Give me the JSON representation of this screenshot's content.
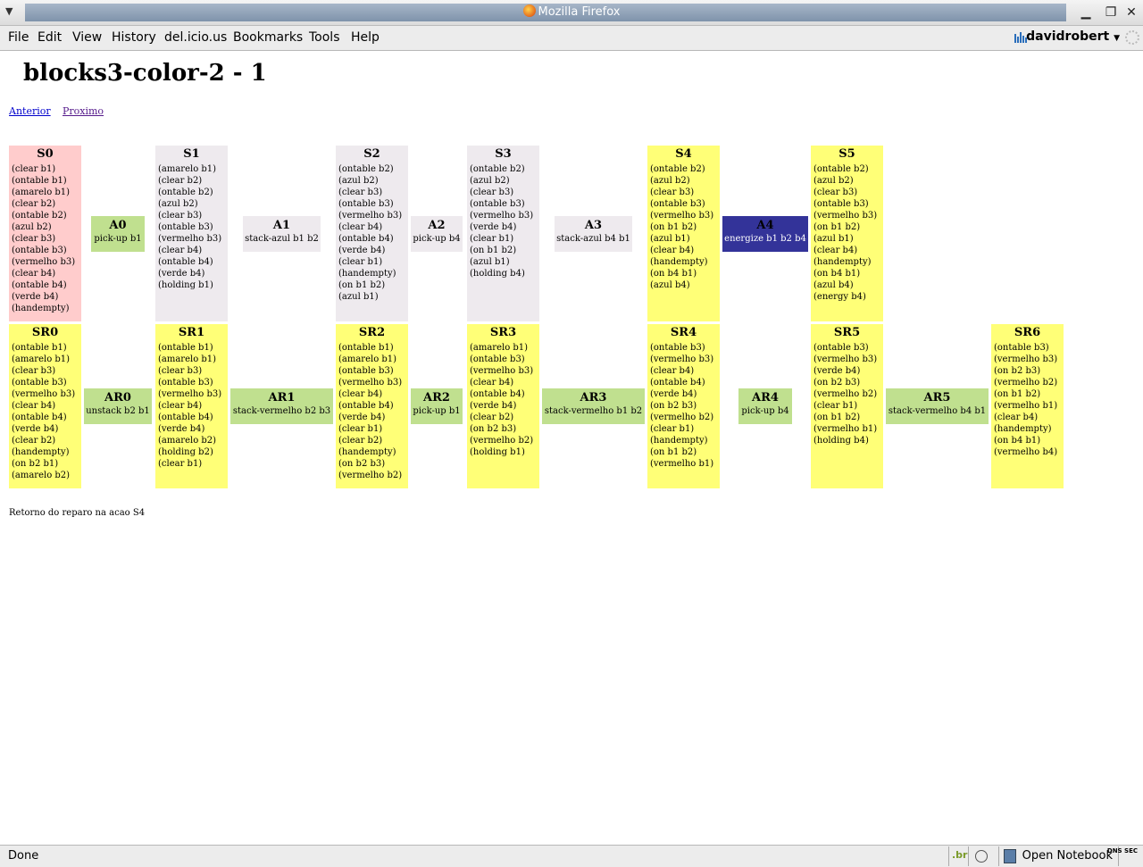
{
  "window": {
    "title": "Mozilla Firefox"
  },
  "menu": [
    "File",
    "Edit",
    "View",
    "History",
    "del.icio.us",
    "Bookmarks",
    "Tools",
    "Help"
  ],
  "user": "davidrobert",
  "page": {
    "title": "blocks3-color-2 - 1",
    "prev": "Anterior",
    "next": "Proximo",
    "note": "Retorno do reparo na acao S4"
  },
  "states_top": [
    {
      "name": "S0",
      "facts": [
        "(clear b1)",
        "(ontable b1)",
        "(amarelo b1)",
        "(clear b2)",
        "(ontable b2)",
        "(azul b2)",
        "(clear b3)",
        "(ontable b3)",
        "(vermelho b3)",
        "(clear b4)",
        "(ontable b4)",
        "(verde b4)",
        "(handempty)"
      ]
    },
    {
      "name": "S1",
      "facts": [
        "(amarelo b1)",
        "(clear b2)",
        "(ontable b2)",
        "(azul b2)",
        "(clear b3)",
        "(ontable b3)",
        "(vermelho b3)",
        "(clear b4)",
        "(ontable b4)",
        "(verde b4)",
        "(holding b1)"
      ]
    },
    {
      "name": "S2",
      "facts": [
        "(ontable b2)",
        "(azul b2)",
        "(clear b3)",
        "(ontable b3)",
        "(vermelho b3)",
        "(clear b4)",
        "(ontable b4)",
        "(verde b4)",
        "(clear b1)",
        "(handempty)",
        "(on b1 b2)",
        "(azul b1)"
      ]
    },
    {
      "name": "S3",
      "facts": [
        "(ontable b2)",
        "(azul b2)",
        "(clear b3)",
        "(ontable b3)",
        "(vermelho b3)",
        "(verde b4)",
        "(clear b1)",
        "(on b1 b2)",
        "(azul b1)",
        "(holding b4)"
      ]
    },
    {
      "name": "S4",
      "facts": [
        "(ontable b2)",
        "(azul b2)",
        "(clear b3)",
        "(ontable b3)",
        "(vermelho b3)",
        "(on b1 b2)",
        "(azul b1)",
        "(clear b4)",
        "(handempty)",
        "(on b4 b1)",
        "(azul b4)"
      ]
    },
    {
      "name": "S5",
      "facts": [
        "(ontable b2)",
        "(azul b2)",
        "(clear b3)",
        "(ontable b3)",
        "(vermelho b3)",
        "(on b1 b2)",
        "(azul b1)",
        "(clear b4)",
        "(handempty)",
        "(on b4 b1)",
        "(azul b4)",
        "(energy b4)"
      ]
    }
  ],
  "actions_top": [
    {
      "name": "A0",
      "label": "pick-up b1"
    },
    {
      "name": "A1",
      "label": "stack-azul b1 b2"
    },
    {
      "name": "A2",
      "label": "pick-up b4"
    },
    {
      "name": "A3",
      "label": "stack-azul b4 b1"
    },
    {
      "name": "A4",
      "label": "energize b1 b2 b4"
    }
  ],
  "states_bottom": [
    {
      "name": "SR0",
      "facts": [
        "(ontable b1)",
        "(amarelo b1)",
        "(clear b3)",
        "(ontable b3)",
        "(vermelho b3)",
        "(clear b4)",
        "(ontable b4)",
        "(verde b4)",
        "(clear b2)",
        "(handempty)",
        "(on b2 b1)",
        "(amarelo b2)"
      ]
    },
    {
      "name": "SR1",
      "facts": [
        "(ontable b1)",
        "(amarelo b1)",
        "(clear b3)",
        "(ontable b3)",
        "(vermelho b3)",
        "(clear b4)",
        "(ontable b4)",
        "(verde b4)",
        "(amarelo b2)",
        "(holding b2)",
        "(clear b1)"
      ]
    },
    {
      "name": "SR2",
      "facts": [
        "(ontable b1)",
        "(amarelo b1)",
        "(ontable b3)",
        "(vermelho b3)",
        "(clear b4)",
        "(ontable b4)",
        "(verde b4)",
        "(clear b1)",
        "(clear b2)",
        "(handempty)",
        "(on b2 b3)",
        "(vermelho b2)"
      ]
    },
    {
      "name": "SR3",
      "facts": [
        "(amarelo b1)",
        "(ontable b3)",
        "(vermelho b3)",
        "(clear b4)",
        "(ontable b4)",
        "(verde b4)",
        "(clear b2)",
        "(on b2 b3)",
        "(vermelho b2)",
        "(holding b1)"
      ]
    },
    {
      "name": "SR4",
      "facts": [
        "(ontable b3)",
        "(vermelho b3)",
        "(clear b4)",
        "(ontable b4)",
        "(verde b4)",
        "(on b2 b3)",
        "(vermelho b2)",
        "(clear b1)",
        "(handempty)",
        "(on b1 b2)",
        "(vermelho b1)"
      ]
    },
    {
      "name": "SR5",
      "facts": [
        "(ontable b3)",
        "(vermelho b3)",
        "(verde b4)",
        "(on b2 b3)",
        "(vermelho b2)",
        "(clear b1)",
        "(on b1 b2)",
        "(vermelho b1)",
        "(holding b4)"
      ]
    },
    {
      "name": "SR6",
      "facts": [
        "(ontable b3)",
        "(vermelho b3)",
        "(on b2 b3)",
        "(vermelho b2)",
        "(on b1 b2)",
        "(vermelho b1)",
        "(clear b4)",
        "(handempty)",
        "(on b4 b1)",
        "(vermelho b4)"
      ]
    }
  ],
  "actions_bottom": [
    {
      "name": "AR0",
      "label": "unstack b2 b1"
    },
    {
      "name": "AR1",
      "label": "stack-vermelho b2 b3"
    },
    {
      "name": "AR2",
      "label": "pick-up b1"
    },
    {
      "name": "AR3",
      "label": "stack-vermelho b1 b2"
    },
    {
      "name": "AR4",
      "label": "pick-up b4"
    },
    {
      "name": "AR5",
      "label": "stack-vermelho b4 b1"
    }
  ],
  "status": {
    "text": "Done",
    "notebook": "Open Notebook",
    "br": ".br",
    "dns": "DNS SEC"
  }
}
